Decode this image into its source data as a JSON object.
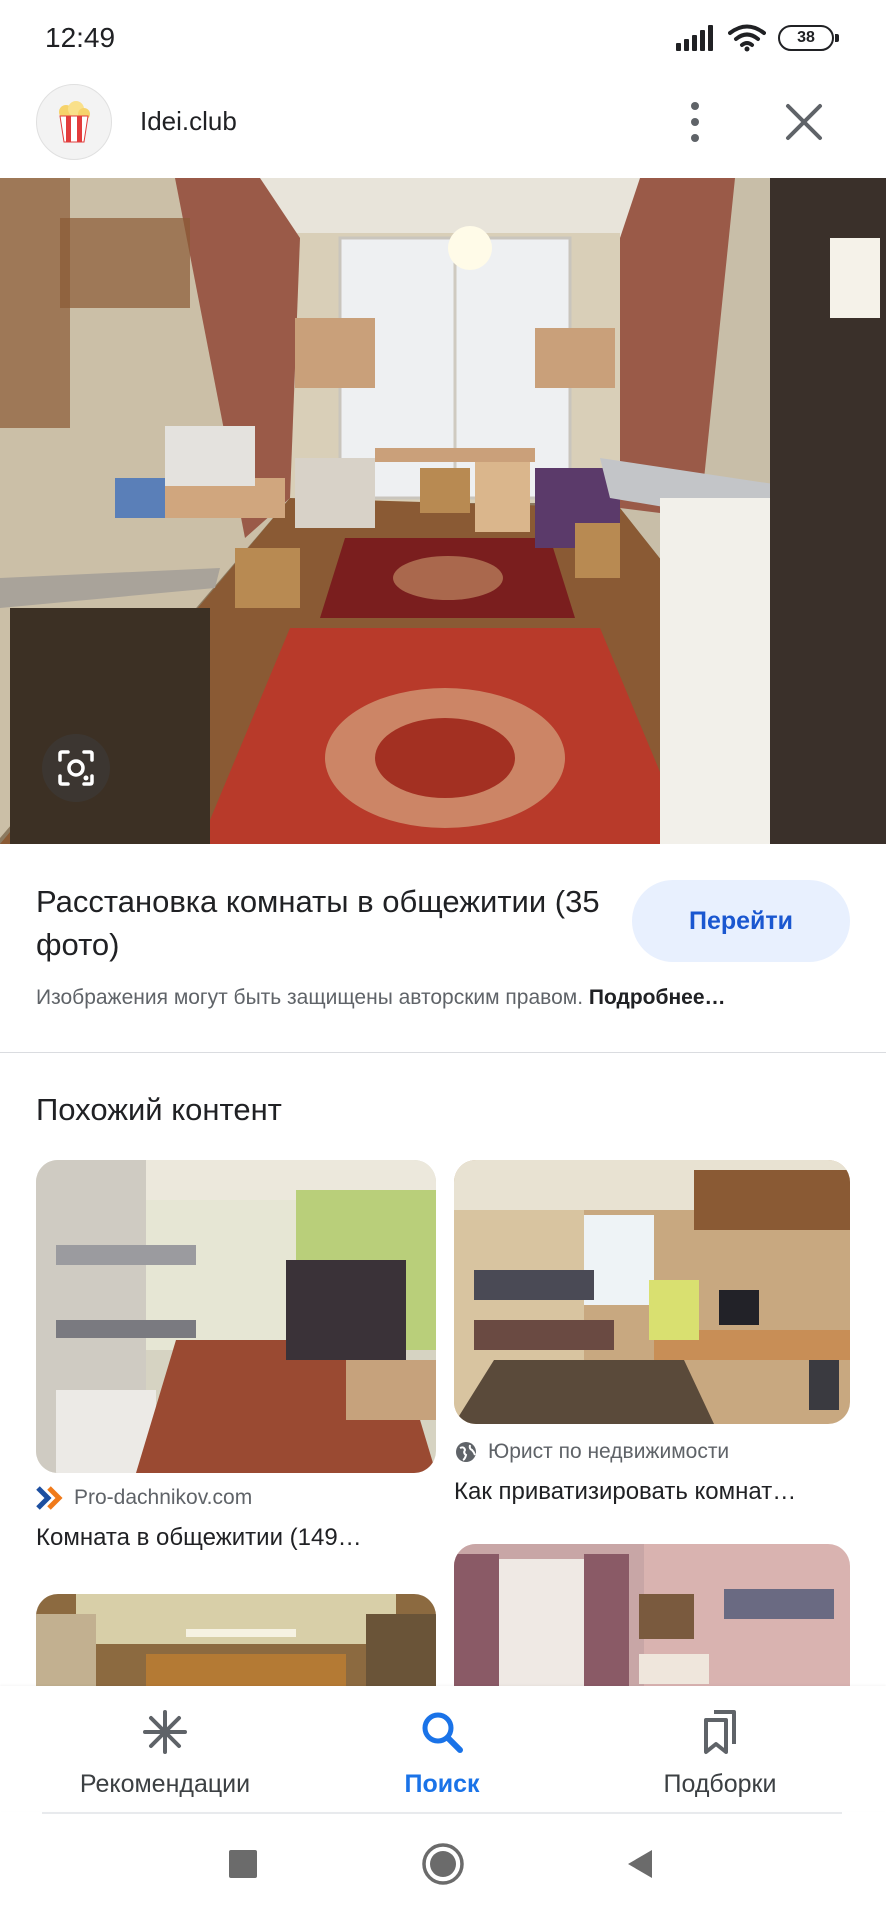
{
  "status_bar": {
    "time": "12:49",
    "battery": "38"
  },
  "header": {
    "site_name": "Idei.club"
  },
  "main": {
    "title": "Расстановка комнаты в общежитии (35 фото)",
    "visit_button": "Перейти",
    "copyright_text": "Изображения могут быть защищены авторским правом. ",
    "more_link": "Подробнее…"
  },
  "related": {
    "title": "Похожий контент",
    "cards": [
      {
        "source": "Pro-dachnikov.com",
        "caption": "Комната в общежитии (149…"
      },
      {
        "source": "Юрист по недвижимости",
        "caption": "Как приватизировать комнат…"
      }
    ]
  },
  "bottom_nav": {
    "items": [
      {
        "label": "Рекомендации",
        "icon": "sparkle-icon",
        "active": false
      },
      {
        "label": "Поиск",
        "icon": "search-icon",
        "active": true
      },
      {
        "label": "Подборки",
        "icon": "collections-icon",
        "active": false
      }
    ]
  },
  "colors": {
    "accent": "#1a73e8",
    "button_bg": "#e8f0fe",
    "text": "#202124",
    "secondary": "#5f6368"
  }
}
